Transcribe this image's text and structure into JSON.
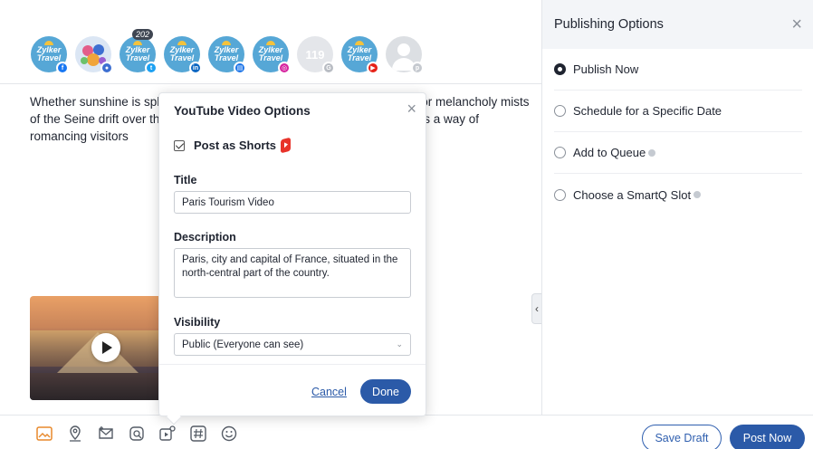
{
  "channels": [
    {
      "name": "zylker-facebook",
      "line1": "Zylker",
      "line2": "Travel",
      "network": "facebook",
      "network_glyph": "f",
      "network_color": "#1877f2"
    },
    {
      "name": "group",
      "network": "group",
      "network_glyph": "●",
      "network_color": "#3d6fd1"
    },
    {
      "name": "zylker-twitter",
      "line1": "Zylker",
      "line2": "Travel",
      "network": "twitter",
      "network_glyph": "t",
      "network_color": "#1da1f2",
      "count": "202"
    },
    {
      "name": "zylker-linkedin",
      "line1": "Zylker",
      "line2": "Travel",
      "network": "linkedin",
      "network_glyph": "in",
      "network_color": "#0a66c2"
    },
    {
      "name": "zylker-gbp",
      "line1": "Zylker",
      "line2": "Travel",
      "network": "google-business",
      "network_glyph": "▤",
      "network_color": "#1a73e8"
    },
    {
      "name": "zylker-instagram",
      "line1": "Zylker",
      "line2": "Travel",
      "network": "instagram",
      "network_glyph": "◎",
      "network_color": "#d6249f"
    },
    {
      "name": "dimmed-channel",
      "line1": "119",
      "network": "google",
      "network_glyph": "G",
      "network_color": "#b8bcc3"
    },
    {
      "name": "zylker-youtube",
      "line1": "Zylker",
      "line2": "Travel",
      "network": "youtube",
      "network_glyph": "▶",
      "network_color": "#e62117"
    },
    {
      "name": "pinterest-channel",
      "network": "pinterest",
      "network_glyph": "p",
      "network_color": "#c5c9cf"
    }
  ],
  "post": {
    "text": "Whether sunshine is splashing across the boulevards of Saint-Germain, or melancholy mists of the Seine drift over the Île de la Cité & Notre Dame cathedral, Paris has a way of romancing visitors"
  },
  "toolbar": {
    "icons": [
      "image-icon",
      "location-icon",
      "mention-icon",
      "gif-icon",
      "youtube-options-icon",
      "hashtag-icon",
      "emoji-icon"
    ]
  },
  "panel": {
    "title": "Publishing Options",
    "options": [
      {
        "label": "Publish Now",
        "selected": true
      },
      {
        "label": "Schedule for a Specific Date",
        "selected": false
      },
      {
        "label": "Add to Queue",
        "selected": false,
        "help": true
      },
      {
        "label": "Choose a SmartQ Slot",
        "selected": false,
        "help": true
      }
    ]
  },
  "actions": {
    "save_draft": "Save Draft",
    "post_now": "Post Now"
  },
  "youtube_modal": {
    "title": "YouTube Video Options",
    "shorts_label": "Post as Shorts",
    "shorts_checked": true,
    "title_label": "Title",
    "title_value": "Paris Tourism Video",
    "description_label": "Description",
    "description_value": "Paris, city and capital of France, situated in the north-central part of the country.",
    "visibility_label": "Visibility",
    "visibility_value": "Public (Everyone can see)",
    "cancel": "Cancel",
    "done": "Done"
  }
}
